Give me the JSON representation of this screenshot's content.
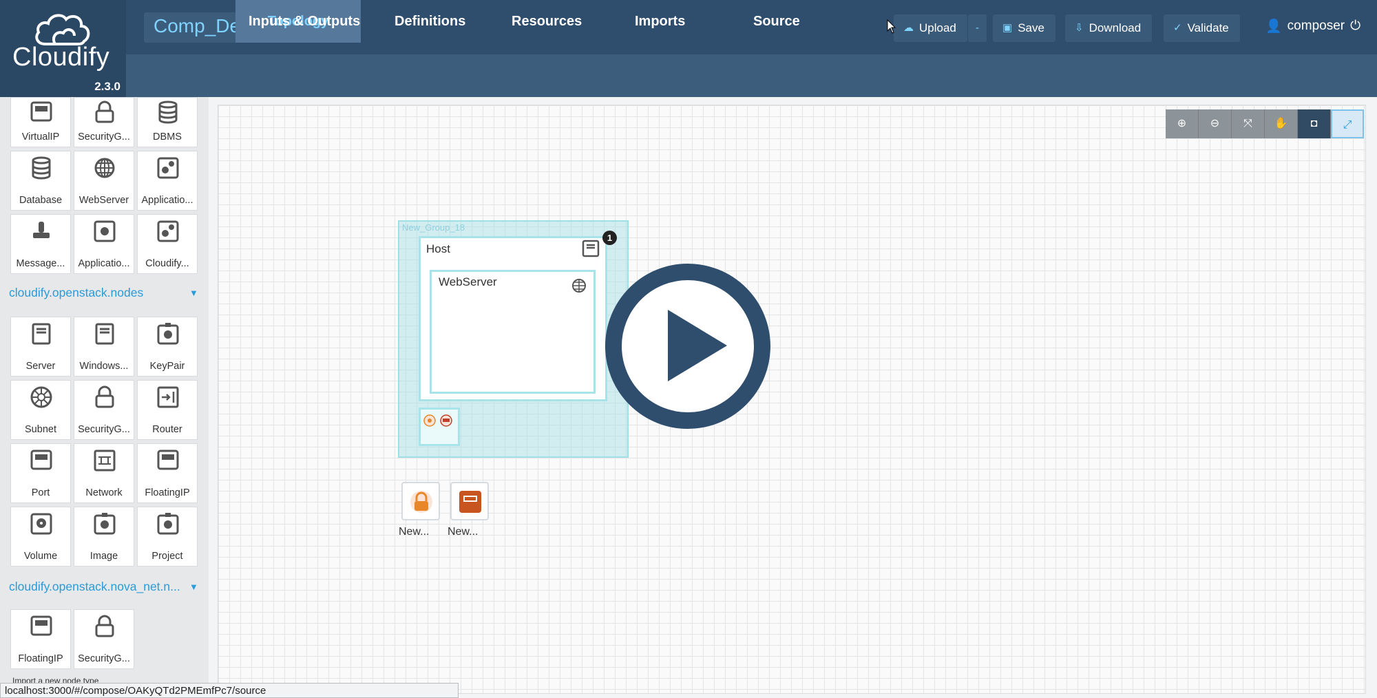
{
  "app": {
    "logo_text": "Cloudify",
    "version": "2.3.0"
  },
  "blueprint": {
    "name": "Comp_Demo",
    "caret": "-"
  },
  "toolbar": {
    "upload_label": "Upload",
    "upload_caret": "-",
    "save_label": "Save",
    "download_label": "Download",
    "validate_label": "Validate"
  },
  "user": {
    "name": "composer"
  },
  "tabs": [
    {
      "label": "Topology",
      "active": true
    },
    {
      "label": "Inputs & Outputs"
    },
    {
      "label": "Definitions"
    },
    {
      "label": "Resources"
    },
    {
      "label": "Imports"
    },
    {
      "label": "Source"
    }
  ],
  "palette": {
    "top_nodes": [
      "VirtualIP",
      "SecurityG...",
      "DBMS",
      "Database",
      "WebServer",
      "Applicatio...",
      "Message...",
      "Applicatio...",
      "Cloudify..."
    ],
    "section_openstack": "cloudify.openstack.nodes",
    "openstack_nodes": [
      "Server",
      "Windows...",
      "KeyPair",
      "Subnet",
      "SecurityG...",
      "Router",
      "Port",
      "Network",
      "FloatingIP",
      "Volume",
      "Image",
      "Project"
    ],
    "section_nova": "cloudify.openstack.nova_net.n...",
    "nova_nodes": [
      "FloatingIP",
      "SecurityG..."
    ],
    "import_label": "Import a new node type"
  },
  "canvas": {
    "group_label": "New_Group_18",
    "host_label": "Host",
    "host_badge": "1",
    "webserver_label": "WebServer",
    "new_node_1": "New...",
    "new_node_2": "New..."
  },
  "status_url": "localhost:3000/#/compose/OAKyQTd2PMEmfPc7/source",
  "colors": {
    "topbar": "#2f4d6c",
    "accent": "#7fd3ff",
    "link": "#2a9bd8",
    "node_orange": "#e8862a"
  }
}
